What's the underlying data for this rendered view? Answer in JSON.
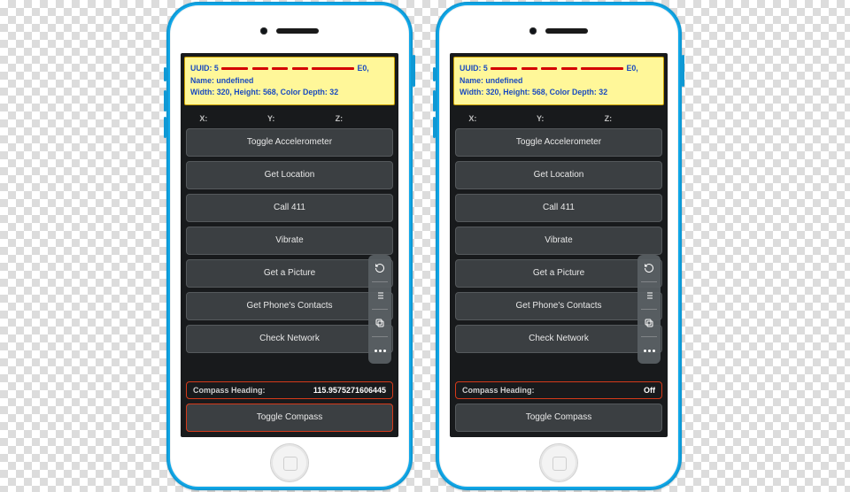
{
  "phones": [
    {
      "info": {
        "uuid_prefix": "UUID: 5",
        "uuid_suffix": "E0,",
        "name_line": "Name: undefined",
        "dims_line": "Width: 320, Height: 568, Color Depth: 32"
      },
      "axes": {
        "x": "X:",
        "y": "Y:",
        "z": "Z:"
      },
      "buttons": [
        "Toggle Accelerometer",
        "Get Location",
        "Call 411",
        "Vibrate",
        "Get a Picture",
        "Get Phone's Contacts",
        "Check Network"
      ],
      "compass": {
        "label": "Compass Heading:",
        "value": "115.9575271606445",
        "highlight_row": true,
        "highlight_toggle": true
      },
      "toggle_compass": "Toggle Compass"
    },
    {
      "info": {
        "uuid_prefix": "UUID: 5",
        "uuid_suffix": "E0,",
        "name_line": "Name: undefined",
        "dims_line": "Width: 320, Height: 568, Color Depth: 32"
      },
      "axes": {
        "x": "X:",
        "y": "Y:",
        "z": "Z:"
      },
      "buttons": [
        "Toggle Accelerometer",
        "Get Location",
        "Call 411",
        "Vibrate",
        "Get a Picture",
        "Get Phone's Contacts",
        "Check Network"
      ],
      "compass": {
        "label": "Compass Heading:",
        "value": "Off",
        "highlight_row": true,
        "highlight_toggle": false
      },
      "toggle_compass": "Toggle Compass"
    }
  ],
  "icons": {
    "refresh": "refresh-icon",
    "list": "list-icon",
    "copy": "copy-icon",
    "more": "more-icon"
  }
}
